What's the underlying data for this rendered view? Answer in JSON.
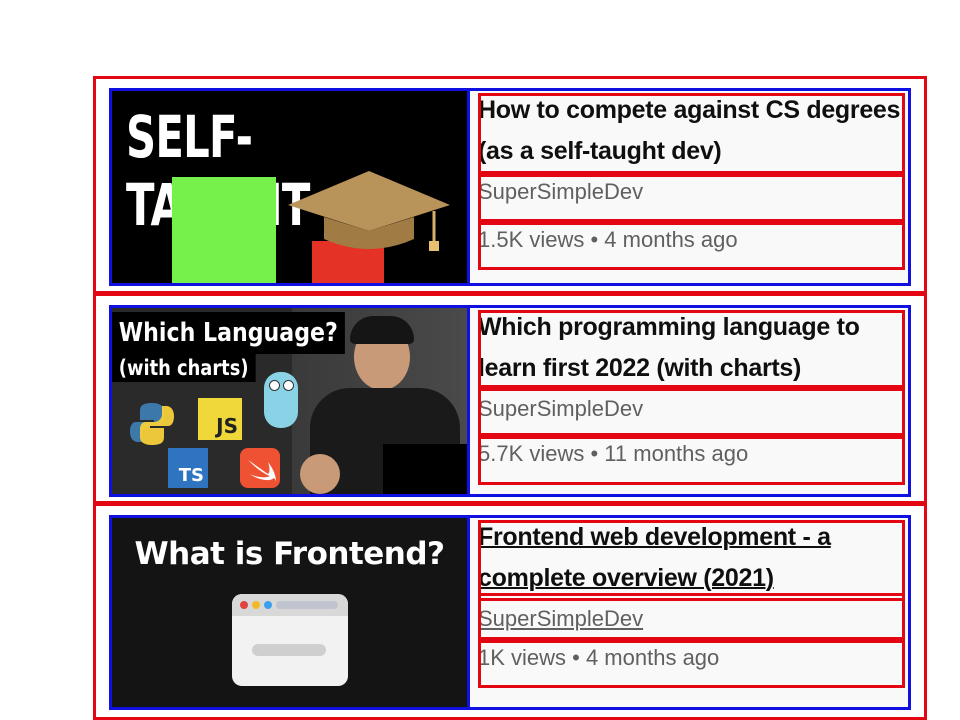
{
  "videos": [
    {
      "title": "How to compete against CS degrees (as a self-taught dev)",
      "channel": "SuperSimpleDev",
      "stats": "1.5K views • 4 months ago",
      "thumbnail": {
        "headline": "SELF-TAUGHT"
      }
    },
    {
      "title": "Which programming language to learn first 2022 (with charts)",
      "channel": "SuperSimpleDev",
      "stats": "5.7K views • 11 months ago",
      "thumbnail": {
        "headline": "Which Language?",
        "subheadline": "(with charts)",
        "badges": [
          "JS",
          "TS"
        ]
      }
    },
    {
      "title": "Frontend web development - a complete overview (2021)",
      "channel": "SuperSimpleDev",
      "stats": "1K views • 4 months ago",
      "thumbnail": {
        "headline": "What is Frontend?"
      }
    }
  ],
  "colors": {
    "outer_outline": "#e30613",
    "inner_outline": "#1010e0",
    "title_text": "#0f0f0f",
    "meta_text": "#606060"
  }
}
